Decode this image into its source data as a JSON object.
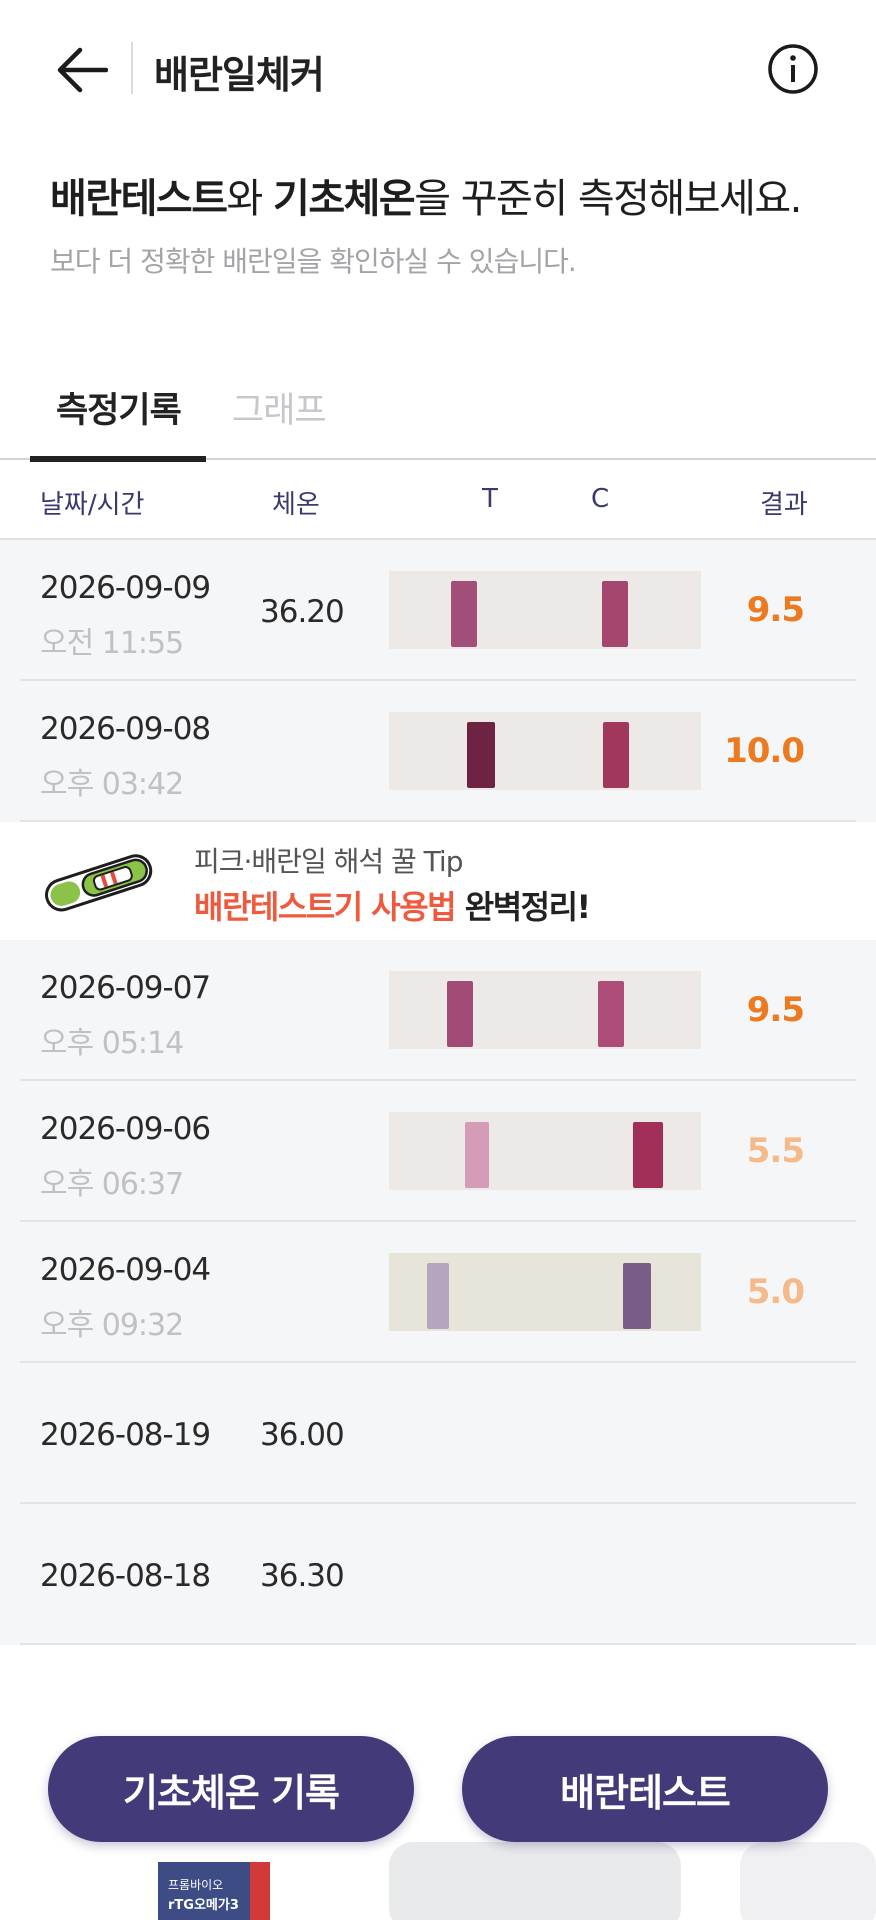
{
  "header": {
    "title": "배란일체커",
    "back_icon": "arrow-left-icon",
    "info_icon": "info-circle-icon"
  },
  "intro": {
    "title_bold_1": "배란테스트",
    "title_light_1": "와 ",
    "title_bold_2": "기초체온",
    "title_light_2": "을 꾸준히 측정해보세요.",
    "subtitle": "보다 더 정확한 배란일을 확인하실 수 있습니다."
  },
  "tabs": [
    {
      "label": "측정기록",
      "active": true
    },
    {
      "label": "그래프",
      "active": false
    }
  ],
  "columns": {
    "datetime": "날짜/시간",
    "temp": "체온",
    "t": "T",
    "c": "C",
    "result": "결과"
  },
  "rows": [
    {
      "date": "2026-09-09",
      "time": "오전 11:55",
      "temp": "36.20",
      "result": "9.5",
      "result_level": "strong"
    },
    {
      "date": "2026-09-08",
      "time": "오후 03:42",
      "temp": "",
      "result": "10.0",
      "result_level": "strong"
    },
    {
      "date": "2026-09-07",
      "time": "오후 05:14",
      "temp": "",
      "result": "9.5",
      "result_level": "strong"
    },
    {
      "date": "2026-09-06",
      "time": "오후 06:37",
      "temp": "",
      "result": "5.5",
      "result_level": "weak"
    },
    {
      "date": "2026-09-04",
      "time": "오후 09:32",
      "temp": "",
      "result": "5.0",
      "result_level": "weak"
    },
    {
      "date": "2026-08-19",
      "time": "",
      "temp": "36.00",
      "result": "",
      "result_level": ""
    },
    {
      "date": "2026-08-18",
      "time": "",
      "temp": "36.30",
      "result": "",
      "result_level": ""
    }
  ],
  "tip": {
    "line1": "피크·배란일 해석 꿀 Tip",
    "line2_highlight": "배란테스트기 사용법",
    "line2_rest": " 완벽정리!",
    "icon": "ovulation-test-stick-icon"
  },
  "buttons": {
    "temp_record": "기초체온 기록",
    "ovulation_test": "배란테스트"
  },
  "product": {
    "line1": "프롬바이오",
    "line2": "rTG오메가3"
  },
  "colors": {
    "accent": "#433b79",
    "result_strong": "#ee7a1f",
    "result_weak": "#f6b98a",
    "tip_highlight": "#ef5a3f"
  }
}
